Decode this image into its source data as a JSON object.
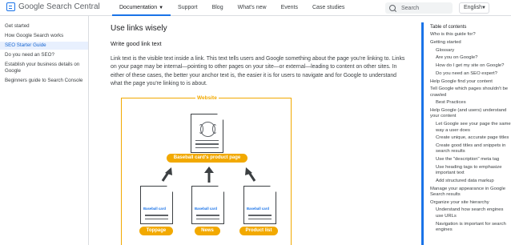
{
  "header": {
    "logo_text": "Google Search Central",
    "nav": [
      {
        "label": "Documentation",
        "active": true
      },
      {
        "label": "Support"
      },
      {
        "label": "Blog"
      },
      {
        "label": "What's new"
      },
      {
        "label": "Events"
      },
      {
        "label": "Case studies"
      }
    ],
    "search_placeholder": "Search",
    "language": "English"
  },
  "leftnav": [
    {
      "label": "Get started"
    },
    {
      "label": "How Google Search works"
    },
    {
      "label": "SEO Starter Guide",
      "active": true
    },
    {
      "label": "Do you need an SEO?"
    },
    {
      "label": "Establish your business details on Google"
    },
    {
      "label": "Beginners guide to Search Console"
    }
  ],
  "main": {
    "title": "Use links wisely",
    "subtitle": "Write good link text",
    "paragraph": "Link text is the visible text inside a link. This text tells users and Google something about the page you're linking to. Links on your page may be internal—pointing to other pages on your site—or external—leading to content on other sites. In either of these cases, the better your anchor text is, the easier it is for users to navigate and for Google to understand what the page you're linking to is about."
  },
  "figure": {
    "title": "Website",
    "top_label": "Baseball card's product page",
    "card_text": "Baseball card",
    "bottom_labels": [
      "Toppage",
      "News",
      "Product list"
    ]
  },
  "toc": {
    "title": "Table of contents",
    "items": [
      {
        "label": "Who is this guide for?",
        "level": 0
      },
      {
        "label": "Getting started",
        "level": 0
      },
      {
        "label": "Glossary",
        "level": 1
      },
      {
        "label": "Are you on Google?",
        "level": 1
      },
      {
        "label": "How do I get my site on Google?",
        "level": 1
      },
      {
        "label": "Do you need an SEO expert?",
        "level": 1
      },
      {
        "label": "Help Google find your content",
        "level": 0
      },
      {
        "label": "Tell Google which pages shouldn't be crawled",
        "level": 0
      },
      {
        "label": "Best Practices",
        "level": 1
      },
      {
        "label": "Help Google (and users) understand your content",
        "level": 0
      },
      {
        "label": "Let Google see your page the same way a user does",
        "level": 1
      },
      {
        "label": "Create unique, accurate page titles",
        "level": 1
      },
      {
        "label": "Create good titles and snippets in search results",
        "level": 1
      },
      {
        "label": "Use the \"description\" meta tag",
        "level": 1
      },
      {
        "label": "Use heading tags to emphasize important text",
        "level": 1
      },
      {
        "label": "Add structured data markup",
        "level": 1
      },
      {
        "label": "Manage your appearance in Google Search results",
        "level": 0
      },
      {
        "label": "Organize your site hierarchy",
        "level": 0
      },
      {
        "label": "Understand how search engines use URLs",
        "level": 1
      },
      {
        "label": "Navigation is important for search engines",
        "level": 1
      }
    ]
  },
  "colors": {
    "accent": "#1a73e8",
    "figure_orange": "#f2a900"
  }
}
